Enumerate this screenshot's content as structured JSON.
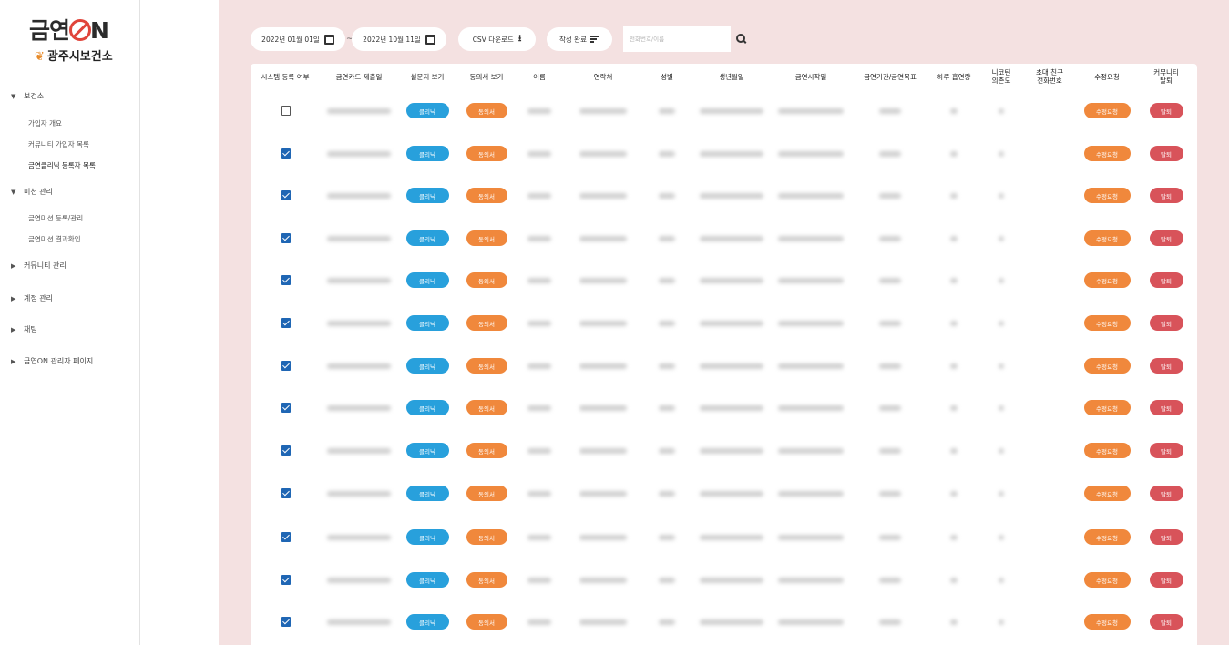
{
  "sidebar": {
    "logo_main": "금연",
    "logo_on": "N",
    "logo_sub": "광주시보건소",
    "sections": [
      {
        "label": "보건소",
        "expanded": true,
        "items": [
          "가입자 개요",
          "커뮤니티 가입자 목록",
          "금연클리닉 등록자 목록"
        ]
      },
      {
        "label": "미션 관리",
        "expanded": true,
        "items": [
          "금연미션 등록/관리",
          "금연미션 결과확인"
        ]
      },
      {
        "label": "커뮤니티 관리",
        "expanded": false,
        "items": []
      },
      {
        "label": "계정 관리",
        "expanded": false,
        "items": []
      },
      {
        "label": "채팅",
        "expanded": false,
        "items": []
      },
      {
        "label": "금연ON 관리자 페이지",
        "expanded": false,
        "items": []
      }
    ],
    "active_item": "금연클리닉 등록자 목록"
  },
  "toolbar": {
    "start_date": "2022년 01월 01일",
    "tilde": "~",
    "end_date": "2022년 10월 11일",
    "csv_label": "CSV 다운로드",
    "sort_label": "작성 완료",
    "search_placeholder": "전화번호/이름"
  },
  "table": {
    "headers": [
      "시스템 등록 여부",
      "금연카드 제출일",
      "설문지 보기",
      "동의서 보기",
      "이름",
      "연락처",
      "성별",
      "생년월일",
      "금연시작일",
      "금연기간/금연목표",
      "하루 흡연량",
      "니코틴\n의존도",
      "초대 친구\n전화번호",
      "수정요청",
      "커뮤니티\n탈퇴"
    ],
    "survey_label": "클리닉",
    "consent_label": "동의서",
    "edit_label": "수정요청",
    "withdraw_label": "탈퇴",
    "rows_registered": [
      false,
      true,
      true,
      true,
      true,
      true,
      true,
      true,
      true,
      true,
      true,
      true,
      true
    ]
  },
  "colors": {
    "accent_blue": "#28a0dc",
    "accent_orange": "#f0883c",
    "accent_red": "#d8535a",
    "main_bg": "#f4e1e1",
    "checkbox_blue": "#1f66b4"
  }
}
